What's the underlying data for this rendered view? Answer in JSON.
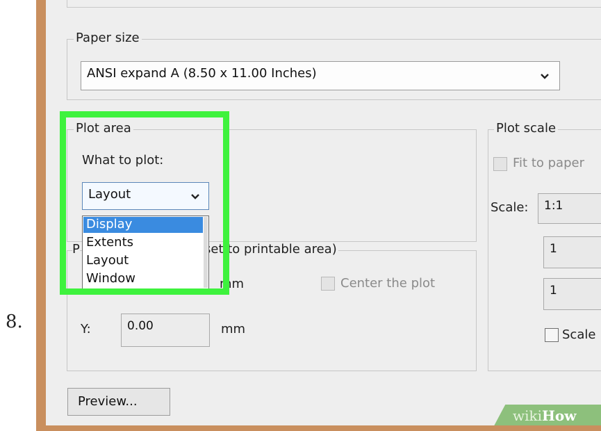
{
  "step_number": "8.",
  "paper_size": {
    "title": "Paper size",
    "selected": "ANSI expand A (8.50 x 11.00 Inches)"
  },
  "plot_area": {
    "title": "Plot area",
    "what_to_plot_label": "What to plot:",
    "selected": "Layout",
    "options": [
      "Display",
      "Extents",
      "Layout",
      "Window"
    ],
    "highlighted_option": "Display"
  },
  "plot_offset": {
    "title_partial": "set to printable area)",
    "title_prefix": "P",
    "x_unit": "mm",
    "y_label": "Y:",
    "y_value": "0.00",
    "y_unit": "mm",
    "center_label": "Center the plot"
  },
  "plot_scale": {
    "title": "Plot scale",
    "fit_label": "Fit to paper",
    "scale_label": "Scale:",
    "scale_value": "1:1",
    "value_1": "1",
    "value_2": "1",
    "scale_checkbox_label": "Scale"
  },
  "preview_button": "Preview...",
  "watermark": {
    "wiki": "wiki",
    "how": "How"
  },
  "colors": {
    "highlight": "#3ef23d",
    "selection": "#3a8be0",
    "frame": "#c98f5e"
  }
}
